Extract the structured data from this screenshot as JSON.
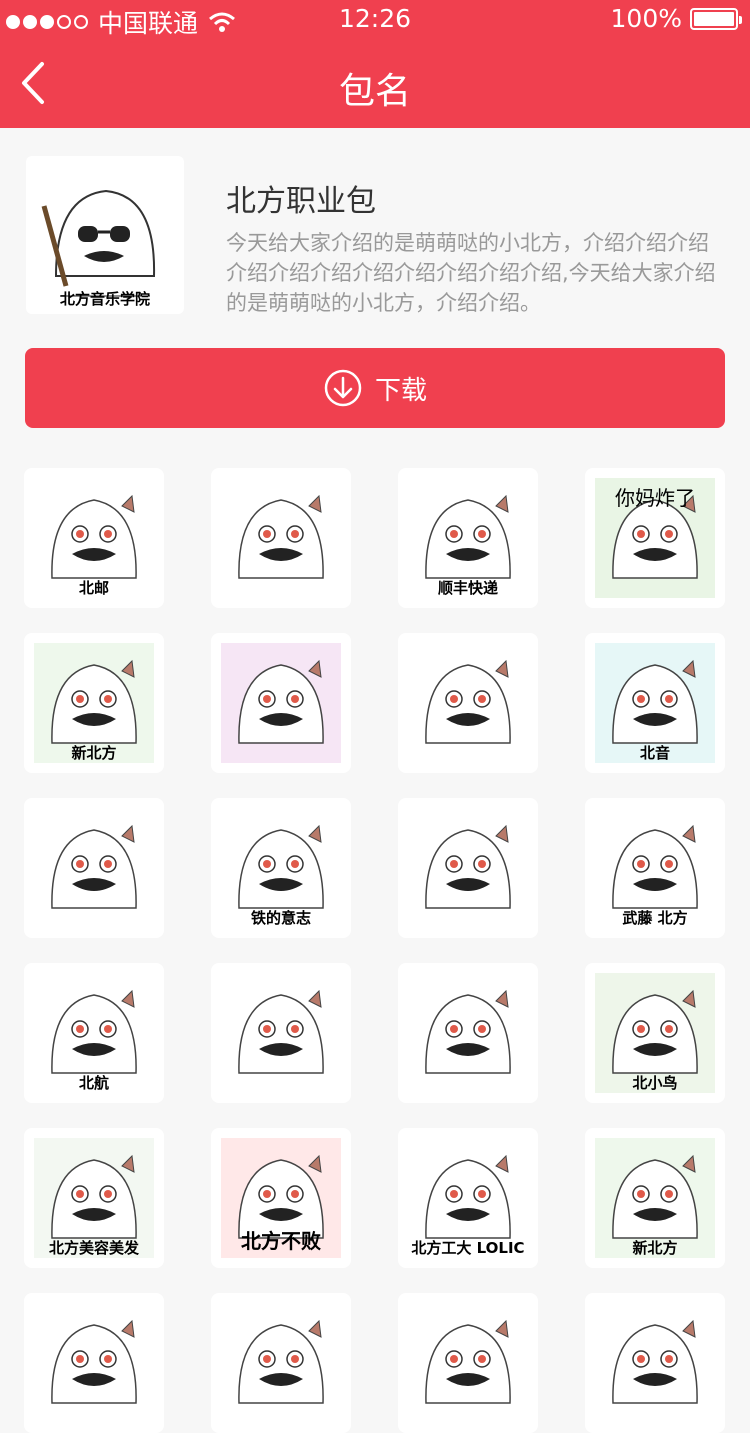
{
  "status_bar": {
    "carrier": "中国联通",
    "time": "12:26",
    "battery": "100%"
  },
  "nav": {
    "title": "包名"
  },
  "package": {
    "cover_caption": "北方音乐学院",
    "name": "北方职业包",
    "description": "今天给大家介绍的是萌萌哒的小北方，介绍介绍介绍介绍介绍介绍介绍介绍介绍介绍介绍,今天给大家介绍的是萌萌哒的小北方，介绍介绍。"
  },
  "download": {
    "label": "下载"
  },
  "stickers": [
    {
      "caption": "北邮"
    },
    {
      "caption": ""
    },
    {
      "caption": "顺丰快递"
    },
    {
      "caption": "你妈炸了"
    },
    {
      "caption": "新北方"
    },
    {
      "caption": ""
    },
    {
      "caption": ""
    },
    {
      "caption": "北音"
    },
    {
      "caption": ""
    },
    {
      "caption": "铁的意志"
    },
    {
      "caption": ""
    },
    {
      "caption": "武藤 北方"
    },
    {
      "caption": "北航"
    },
    {
      "caption": ""
    },
    {
      "caption": ""
    },
    {
      "caption": "北小鸟"
    },
    {
      "caption": "北方美容美发"
    },
    {
      "caption": "北方不败"
    },
    {
      "caption": "北方工大 LOLIC"
    },
    {
      "caption": "新北方"
    },
    {
      "caption": ""
    },
    {
      "caption": ""
    },
    {
      "caption": ""
    },
    {
      "caption": ""
    }
  ],
  "colors": {
    "accent": "#f0404f",
    "background": "#f7f7f7"
  }
}
